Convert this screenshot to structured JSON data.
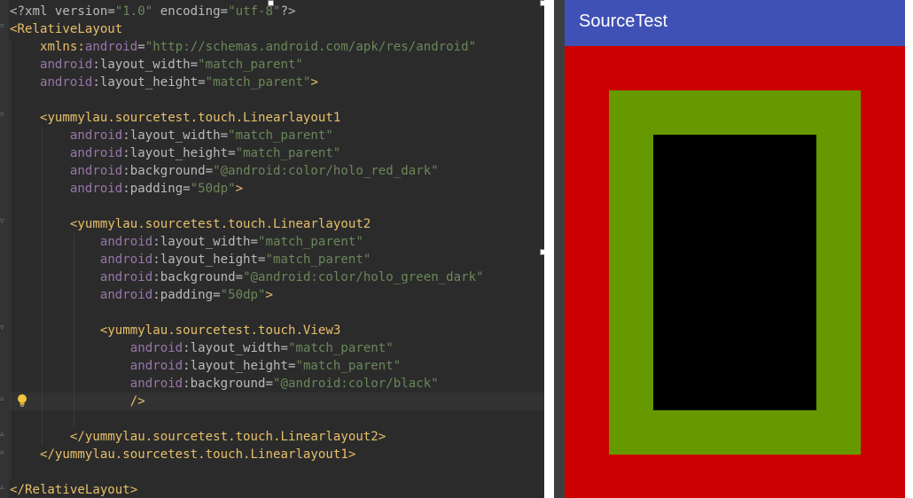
{
  "editor": {
    "lines": [
      {
        "segments": [
          {
            "c": "p",
            "t": "<?xml version="
          },
          {
            "c": "v",
            "t": "\"1.0\""
          },
          {
            "c": "p",
            "t": " encoding="
          },
          {
            "c": "v",
            "t": "\"utf-8\""
          },
          {
            "c": "p",
            "t": "?>"
          }
        ]
      },
      {
        "segments": [
          {
            "c": "t",
            "t": "<RelativeLayout"
          }
        ]
      },
      {
        "segments": [
          {
            "c": "p",
            "t": "    "
          },
          {
            "c": "t",
            "t": "xmlns:"
          },
          {
            "c": "a",
            "t": "android"
          },
          {
            "c": "p",
            "t": "="
          },
          {
            "c": "v",
            "t": "\"http://schemas.android.com/apk/res/android\""
          }
        ]
      },
      {
        "segments": [
          {
            "c": "p",
            "t": "    "
          },
          {
            "c": "a",
            "t": "android"
          },
          {
            "c": "p",
            "t": ":layout_width="
          },
          {
            "c": "v",
            "t": "\"match_parent\""
          }
        ]
      },
      {
        "segments": [
          {
            "c": "p",
            "t": "    "
          },
          {
            "c": "a",
            "t": "android"
          },
          {
            "c": "p",
            "t": ":layout_height="
          },
          {
            "c": "v",
            "t": "\"match_parent\""
          },
          {
            "c": "t",
            "t": ">"
          }
        ]
      },
      {
        "segments": []
      },
      {
        "segments": [
          {
            "c": "p",
            "t": "    "
          },
          {
            "c": "t",
            "t": "<yummylau.sourcetest.touch.Linearlayout1"
          }
        ]
      },
      {
        "segments": [
          {
            "c": "p",
            "t": "        "
          },
          {
            "c": "a",
            "t": "android"
          },
          {
            "c": "p",
            "t": ":layout_width="
          },
          {
            "c": "v",
            "t": "\"match_parent\""
          }
        ]
      },
      {
        "segments": [
          {
            "c": "p",
            "t": "        "
          },
          {
            "c": "a",
            "t": "android"
          },
          {
            "c": "p",
            "t": ":layout_height="
          },
          {
            "c": "v",
            "t": "\"match_parent\""
          }
        ]
      },
      {
        "segments": [
          {
            "c": "p",
            "t": "        "
          },
          {
            "c": "a",
            "t": "android"
          },
          {
            "c": "p",
            "t": ":background="
          },
          {
            "c": "v",
            "t": "\"@android:color/holo_red_dark\""
          }
        ]
      },
      {
        "segments": [
          {
            "c": "p",
            "t": "        "
          },
          {
            "c": "a",
            "t": "android"
          },
          {
            "c": "p",
            "t": ":padding="
          },
          {
            "c": "v",
            "t": "\"50dp\""
          },
          {
            "c": "t",
            "t": ">"
          }
        ]
      },
      {
        "segments": []
      },
      {
        "segments": [
          {
            "c": "p",
            "t": "        "
          },
          {
            "c": "t",
            "t": "<yummylau.sourcetest.touch.Linearlayout2"
          }
        ]
      },
      {
        "segments": [
          {
            "c": "p",
            "t": "            "
          },
          {
            "c": "a",
            "t": "android"
          },
          {
            "c": "p",
            "t": ":layout_width="
          },
          {
            "c": "v",
            "t": "\"match_parent\""
          }
        ]
      },
      {
        "segments": [
          {
            "c": "p",
            "t": "            "
          },
          {
            "c": "a",
            "t": "android"
          },
          {
            "c": "p",
            "t": ":layout_height="
          },
          {
            "c": "v",
            "t": "\"match_parent\""
          }
        ]
      },
      {
        "segments": [
          {
            "c": "p",
            "t": "            "
          },
          {
            "c": "a",
            "t": "android"
          },
          {
            "c": "p",
            "t": ":background="
          },
          {
            "c": "v",
            "t": "\"@android:color/holo_green_dark\""
          }
        ]
      },
      {
        "segments": [
          {
            "c": "p",
            "t": "            "
          },
          {
            "c": "a",
            "t": "android"
          },
          {
            "c": "p",
            "t": ":padding="
          },
          {
            "c": "v",
            "t": "\"50dp\""
          },
          {
            "c": "t",
            "t": ">"
          }
        ]
      },
      {
        "segments": []
      },
      {
        "segments": [
          {
            "c": "p",
            "t": "            "
          },
          {
            "c": "t",
            "t": "<yummylau.sourcetest.touch.View3"
          }
        ]
      },
      {
        "segments": [
          {
            "c": "p",
            "t": "                "
          },
          {
            "c": "a",
            "t": "android"
          },
          {
            "c": "p",
            "t": ":layout_width="
          },
          {
            "c": "v",
            "t": "\"match_parent\""
          }
        ]
      },
      {
        "segments": [
          {
            "c": "p",
            "t": "                "
          },
          {
            "c": "a",
            "t": "android"
          },
          {
            "c": "p",
            "t": ":layout_height="
          },
          {
            "c": "v",
            "t": "\"match_parent\""
          }
        ]
      },
      {
        "segments": [
          {
            "c": "p",
            "t": "                "
          },
          {
            "c": "a",
            "t": "android"
          },
          {
            "c": "p",
            "t": ":background="
          },
          {
            "c": "v",
            "t": "\"@android:color/black\""
          }
        ]
      },
      {
        "segments": [
          {
            "c": "p",
            "t": "                "
          },
          {
            "c": "t",
            "t": "/>"
          }
        ]
      },
      {
        "segments": []
      },
      {
        "segments": [
          {
            "c": "p",
            "t": "        "
          },
          {
            "c": "t",
            "t": "</yummylau.sourcetest.touch.Linearlayout2>"
          }
        ]
      },
      {
        "segments": [
          {
            "c": "p",
            "t": "    "
          },
          {
            "c": "t",
            "t": "</yummylau.sourcetest.touch.Linearlayout1>"
          }
        ]
      },
      {
        "segments": []
      },
      {
        "segments": [
          {
            "c": "t",
            "t": "</RelativeLayout>"
          }
        ]
      }
    ],
    "lightbulb_icon": "lightbulb-icon"
  },
  "preview": {
    "app_title": "SourceTest",
    "colors": {
      "app_bar": "#3f51b5",
      "linearlayout1_background": "#cc0000",
      "linearlayout2_background": "#669900",
      "view3_background": "#000000"
    }
  }
}
